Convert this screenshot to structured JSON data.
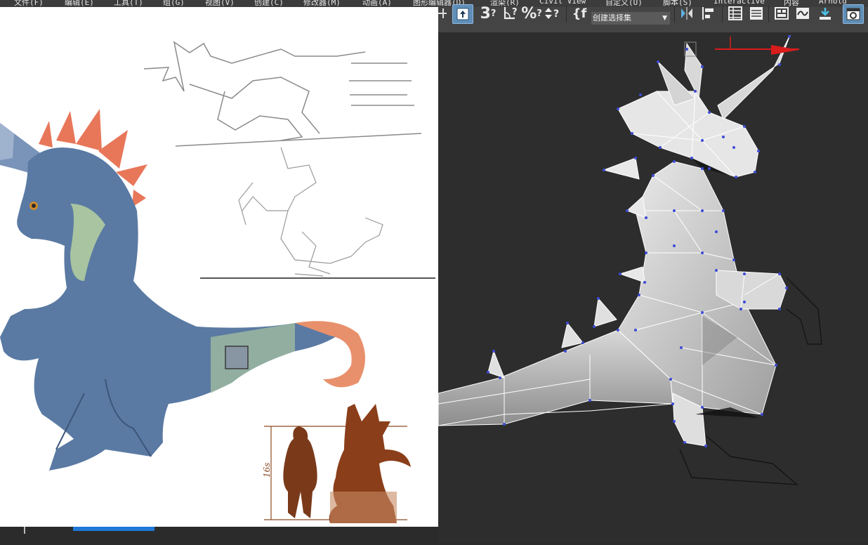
{
  "menu": {
    "items": [
      "文件(F)",
      "编辑(E)",
      "工具(T)",
      "组(G)",
      "视图(V)",
      "创建(C)",
      "修改器(M)",
      "动画(A)",
      "图形编辑器(D)",
      "渲染(R)",
      "Civil View",
      "自定义(U)",
      "脚本(S)",
      "Interactive",
      "内容",
      "Arnold"
    ]
  },
  "toolbar": {
    "selection_set": "创建选择集",
    "snap_3d_icon": "3",
    "angle_snap_icon": "angle-snap",
    "percent_snap_icon": "%",
    "spinner_snap_icon": "spinner-snap",
    "edit_named_sel_icon": "{f"
  },
  "reference": {
    "height_label": "16s"
  },
  "colors": {
    "dragon_body": "#5a7aa3",
    "dragon_belly": "#a8c4a0",
    "dragon_spikes": "#e8775a",
    "silhouette_dark": "#6b2e14",
    "silhouette_light": "#c68a62",
    "mesh_face": "#d9d9d9",
    "mesh_vertex": "#3d4bd6",
    "gizmo_x": "#d81c1c",
    "viewport_bg": "#2d2d2d",
    "toolbar_bg": "#444444"
  }
}
